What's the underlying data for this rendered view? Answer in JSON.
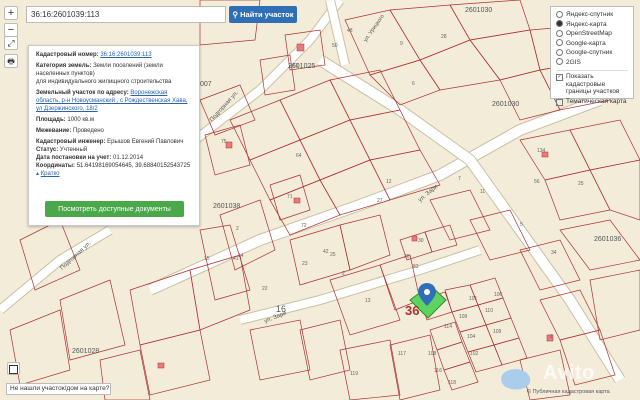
{
  "search": {
    "value": "36:16:2601039:113",
    "button_label": "Найти участок"
  },
  "zoom": {
    "plus": "+",
    "minus": "−",
    "fullscreen": "⤢",
    "print": "🖶"
  },
  "info_panel": {
    "cadastral_number_label": "Кадастровый номер:",
    "cadastral_number_value": "36:16:2601039:113",
    "land_category_label": "Категория земель:",
    "land_category_value": "Земли поселений (земли населенных пунктов)",
    "permitted_use": "для индивидуального жилищного строительства",
    "address_label": "Земельный участок по адресу:",
    "address_value": "Воронежская область, р-н Новоусманский , с Рождественская Хава, ул Дзержинского, 18/2",
    "area_label": "Площадь:",
    "area_value": "1000 кв.м",
    "survey_label": "Межевание:",
    "survey_value": "Проведено",
    "engineer_label": "Кадастровый инженер:",
    "engineer_value": "Ерышов Евгений Павлович",
    "status_label": "Статус:",
    "status_value": "Учтенный",
    "registration_date_label": "Дата постановки на учет:",
    "registration_date_value": "01.12.2014",
    "coords_label": "Координаты:",
    "coords_value": "51.64198169054645, 39.68840152543725",
    "collapse_link": "Кратко",
    "documents_button": "Посмотреть доступные документы"
  },
  "layers": {
    "base": [
      {
        "label": "Яндекс-спутник",
        "selected": false
      },
      {
        "label": "Яндекс-карта",
        "selected": true
      },
      {
        "label": "OpenStreetMap",
        "selected": false
      },
      {
        "label": "Google-карта",
        "selected": false
      },
      {
        "label": "Google-спутник",
        "selected": false
      },
      {
        "label": "2GIS",
        "selected": false
      }
    ],
    "overlays": [
      {
        "label": "Показать кадастровые границы участков",
        "checked": true
      },
      {
        "label": "Тематическая карта",
        "checked": false
      }
    ]
  },
  "map_labels": {
    "block_2601030_top": "2601030",
    "block_2601030_right": "2601030",
    "block_2601025": "2601025",
    "block_2601038": "2601038",
    "block_2601036": "2601036",
    "block_2601028": "2601028",
    "block_007": "007",
    "block_16": "16",
    "block_36": "36",
    "street_podgornaya_1": "Подгорная ул.",
    "street_podgornaya_2": "Подгорная ул.",
    "street_zari_1": "ул. Зари",
    "street_zari_2": "ул. Зари",
    "street_uritskogo": "ул. Урицкого",
    "parcel_numbers": [
      "48",
      "9",
      "28",
      "50",
      "6",
      "61",
      "75",
      "64",
      "27",
      "71",
      "72",
      "2",
      "42",
      "14",
      "15",
      "22",
      "23",
      "25",
      "41",
      "30",
      "83",
      "26",
      "2",
      "13",
      "7",
      "11",
      "101",
      "106",
      "109",
      "110",
      "104",
      "109",
      "114",
      "102",
      "108",
      "116",
      "118",
      "119",
      "117",
      "134",
      "5",
      "34",
      "25",
      "56",
      "12",
      "2",
      "5"
    ]
  },
  "bottom": {
    "help_text": "Не нашли участок/дом на карте?",
    "attribution": "© Публичная кадастровая карта",
    "watermark": "Avito"
  },
  "colors": {
    "map_bg": "#f2ecd9",
    "parcel_border": "#b03030",
    "selected_fill": "#5fd35f",
    "road": "#ffffff",
    "road_border": "#c9c0a4",
    "accent_blue": "#2f6fb6",
    "green_button": "#4aa84a",
    "marker": "#2f6fb6"
  }
}
